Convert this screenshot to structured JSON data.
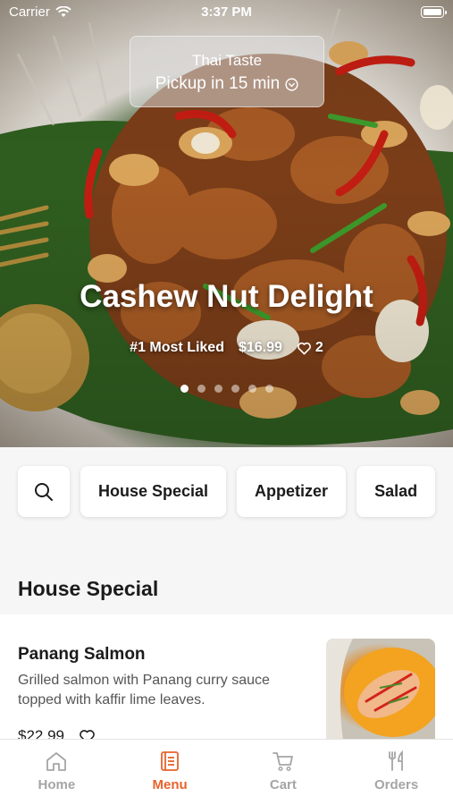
{
  "status_bar": {
    "carrier": "Carrier",
    "time": "3:37 PM"
  },
  "pickup": {
    "store_name": "Thai Taste",
    "pickup_text": "Pickup in 15 min"
  },
  "hero": {
    "title": "Cashew Nut Delight",
    "tag": "#1 Most Liked",
    "price": "$16.99",
    "likes": "2",
    "slides_total": 6,
    "active_slide": 1
  },
  "categories": {
    "search_icon": "search-icon",
    "items": [
      "House Special",
      "Appetizer",
      "Salad"
    ]
  },
  "section": {
    "title": "House Special"
  },
  "menu_items": [
    {
      "name": "Panang Salmon",
      "description": "Grilled salmon with Panang curry sauce topped with kaffir lime leaves.",
      "price": "$22.99"
    }
  ],
  "tabbar": {
    "tabs": [
      {
        "label": "Home",
        "icon": "home-icon"
      },
      {
        "label": "Menu",
        "icon": "menu-icon"
      },
      {
        "label": "Cart",
        "icon": "cart-icon"
      },
      {
        "label": "Orders",
        "icon": "orders-icon"
      }
    ],
    "active": "Menu"
  },
  "colors": {
    "accent": "#e8622c",
    "inactive": "#a5a5a5"
  }
}
